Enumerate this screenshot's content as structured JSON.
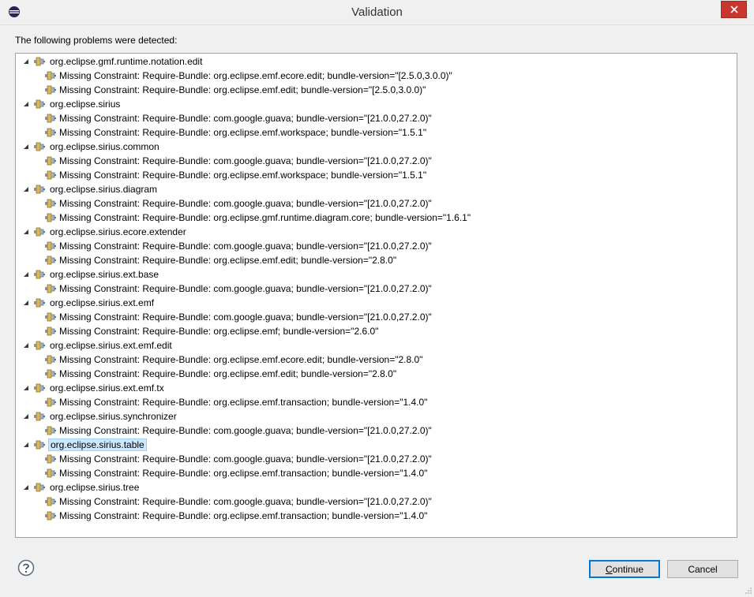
{
  "window": {
    "title": "Validation"
  },
  "prompt": "The following problems were detected:",
  "tree": [
    {
      "label": "org.eclipse.gmf.runtime.notation.edit",
      "children": [
        "Missing Constraint: Require-Bundle: org.eclipse.emf.ecore.edit; bundle-version=\"[2.5.0,3.0.0)\"",
        "Missing Constraint: Require-Bundle: org.eclipse.emf.edit; bundle-version=\"[2.5.0,3.0.0)\""
      ]
    },
    {
      "label": "org.eclipse.sirius",
      "children": [
        "Missing Constraint: Require-Bundle: com.google.guava; bundle-version=\"[21.0.0,27.2.0)\"",
        "Missing Constraint: Require-Bundle: org.eclipse.emf.workspace; bundle-version=\"1.5.1\""
      ]
    },
    {
      "label": "org.eclipse.sirius.common",
      "children": [
        "Missing Constraint: Require-Bundle: com.google.guava; bundle-version=\"[21.0.0,27.2.0)\"",
        "Missing Constraint: Require-Bundle: org.eclipse.emf.workspace; bundle-version=\"1.5.1\""
      ]
    },
    {
      "label": "org.eclipse.sirius.diagram",
      "children": [
        "Missing Constraint: Require-Bundle: com.google.guava; bundle-version=\"[21.0.0,27.2.0)\"",
        "Missing Constraint: Require-Bundle: org.eclipse.gmf.runtime.diagram.core; bundle-version=\"1.6.1\""
      ]
    },
    {
      "label": "org.eclipse.sirius.ecore.extender",
      "children": [
        "Missing Constraint: Require-Bundle: com.google.guava; bundle-version=\"[21.0.0,27.2.0)\"",
        "Missing Constraint: Require-Bundle: org.eclipse.emf.edit; bundle-version=\"2.8.0\""
      ]
    },
    {
      "label": "org.eclipse.sirius.ext.base",
      "children": [
        "Missing Constraint: Require-Bundle: com.google.guava; bundle-version=\"[21.0.0,27.2.0)\""
      ]
    },
    {
      "label": "org.eclipse.sirius.ext.emf",
      "children": [
        "Missing Constraint: Require-Bundle: com.google.guava; bundle-version=\"[21.0.0,27.2.0)\"",
        "Missing Constraint: Require-Bundle: org.eclipse.emf; bundle-version=\"2.6.0\""
      ]
    },
    {
      "label": "org.eclipse.sirius.ext.emf.edit",
      "children": [
        "Missing Constraint: Require-Bundle: org.eclipse.emf.ecore.edit; bundle-version=\"2.8.0\"",
        "Missing Constraint: Require-Bundle: org.eclipse.emf.edit; bundle-version=\"2.8.0\""
      ]
    },
    {
      "label": "org.eclipse.sirius.ext.emf.tx",
      "children": [
        "Missing Constraint: Require-Bundle: org.eclipse.emf.transaction; bundle-version=\"1.4.0\""
      ]
    },
    {
      "label": "org.eclipse.sirius.synchronizer",
      "children": [
        "Missing Constraint: Require-Bundle: com.google.guava; bundle-version=\"[21.0.0,27.2.0)\""
      ]
    },
    {
      "label": "org.eclipse.sirius.table",
      "selected": true,
      "children": [
        "Missing Constraint: Require-Bundle: com.google.guava; bundle-version=\"[21.0.0,27.2.0)\"",
        "Missing Constraint: Require-Bundle: org.eclipse.emf.transaction; bundle-version=\"1.4.0\""
      ]
    },
    {
      "label": "org.eclipse.sirius.tree",
      "children": [
        "Missing Constraint: Require-Bundle: com.google.guava; bundle-version=\"[21.0.0,27.2.0)\"",
        "Missing Constraint: Require-Bundle: org.eclipse.emf.transaction; bundle-version=\"1.4.0\""
      ]
    }
  ],
  "buttons": {
    "continue_label": "Continue",
    "cancel_label": "Cancel"
  },
  "icons": {
    "app": "eclipse-icon",
    "close": "close-icon",
    "bundle": "plugin-icon",
    "help": "help-icon"
  },
  "colors": {
    "selection_bg": "#cce8ff",
    "close_bg": "#c7372e",
    "default_button_border": "#0078d7"
  }
}
